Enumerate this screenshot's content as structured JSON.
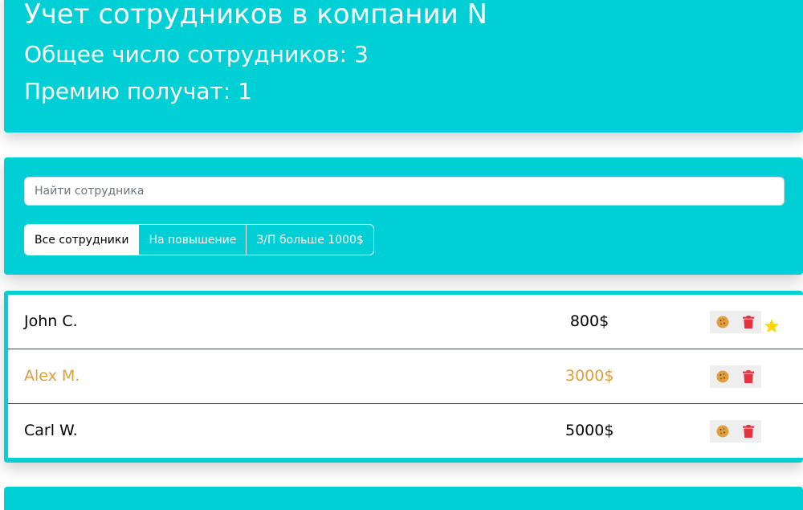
{
  "header": {
    "title": "Учет сотрудников в компании N",
    "total": "Общее число сотрудников: 3",
    "bonus": "Премию получат: 1"
  },
  "search": {
    "placeholder": "Найти сотрудника",
    "value": ""
  },
  "filters": [
    {
      "label": "Все сотрудники",
      "active": true
    },
    {
      "label": "На повышение",
      "active": false
    },
    {
      "label": "З/П больше 1000$",
      "active": false
    }
  ],
  "employees": [
    {
      "name": "John C.",
      "salary": "800$",
      "increase": false,
      "like": true
    },
    {
      "name": "Alex M.",
      "salary": "3000$",
      "increase": true,
      "like": false
    },
    {
      "name": "Carl W.",
      "salary": "5000$",
      "increase": false,
      "like": false
    }
  ],
  "icons": {
    "cookie": "cookie-icon",
    "trash": "trash-icon",
    "star": "star-icon"
  },
  "colors": {
    "accent": "#00cfd6",
    "increase": "#e09f3e",
    "cookie": "#e09f3e",
    "trash": "#e6323e",
    "star": "#ffd700"
  }
}
